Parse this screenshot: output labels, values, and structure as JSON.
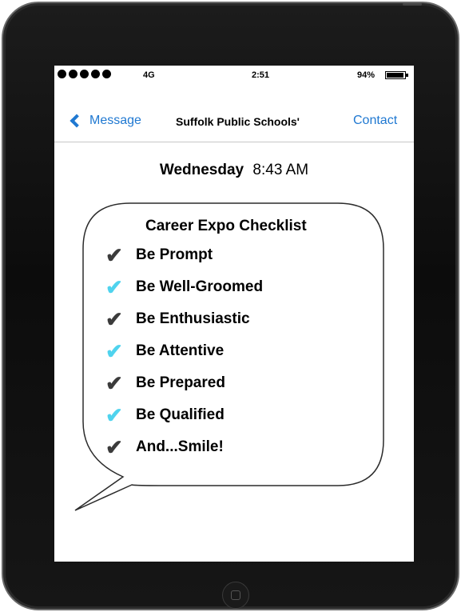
{
  "status_bar": {
    "signal_dots": 5,
    "carrier": "4G",
    "time": "2:51",
    "battery_percent": "94%",
    "battery_level": 0.94
  },
  "nav": {
    "back_label": "Message",
    "title": "Suffolk Public Schools'",
    "action_label": "Contact"
  },
  "message": {
    "day": "Wednesday",
    "time": "8:43 AM",
    "bubble": {
      "title": "Career Expo Checklist",
      "items": [
        {
          "label": "Be Prompt",
          "check_color": "dark"
        },
        {
          "label": "Be Well-Groomed",
          "check_color": "cyan"
        },
        {
          "label": "Be Enthusiastic",
          "check_color": "dark"
        },
        {
          "label": "Be Attentive",
          "check_color": "cyan"
        },
        {
          "label": "Be Prepared",
          "check_color": "dark"
        },
        {
          "label": "Be Qualified",
          "check_color": "cyan"
        },
        {
          "label": "And...Smile!",
          "check_color": "dark"
        }
      ]
    }
  },
  "colors": {
    "link_blue": "#1f78d1",
    "check_dark": "#3b3b3b",
    "check_cyan": "#4fd3ee"
  },
  "icons": {
    "back": "chevron-left-icon",
    "check": "checkmark-icon",
    "home": "home-button-icon"
  }
}
